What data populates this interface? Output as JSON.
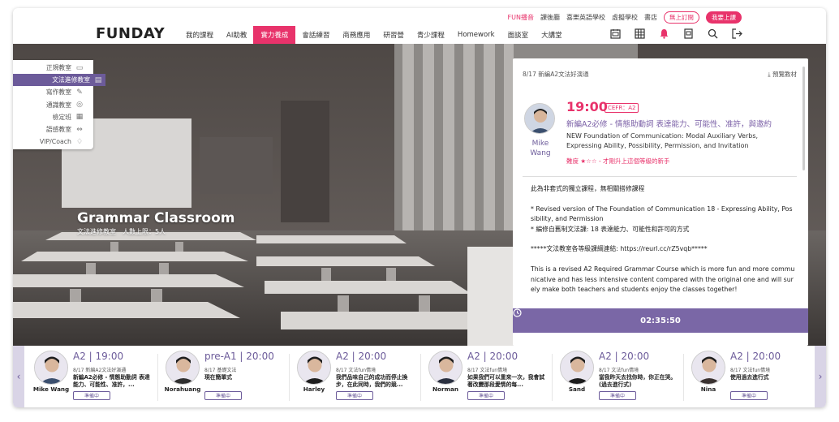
{
  "topbar": {
    "links": [
      "FUN播音",
      "課後廳",
      "喜樂英語學校",
      "虛擬學校",
      "書店"
    ],
    "pill_outline": "無上訂閱",
    "pill_fill": "我要上課"
  },
  "nav": {
    "logo": "FUNDAY",
    "items": [
      "我的課程",
      "AI助教",
      "實力養成",
      "會話練習",
      "商務應用",
      "研習營",
      "青少課程",
      "Homework",
      "面談室",
      "大講堂"
    ],
    "active_index": 2,
    "icons": [
      "calendar-icon",
      "grid-icon",
      "bell-icon",
      "book-icon",
      "search-icon",
      "logout-icon"
    ]
  },
  "left_menu": {
    "items": [
      {
        "label": "正規教室",
        "icon": "▭"
      },
      {
        "label": "文法進修教室",
        "icon": "▤"
      },
      {
        "label": "寫作教室",
        "icon": "✎"
      },
      {
        "label": "通識教室",
        "icon": "◎"
      },
      {
        "label": "檢定班",
        "icon": "▦"
      },
      {
        "label": "語感教室",
        "icon": "⇔"
      },
      {
        "label": "VIP/Coach",
        "icon": "♢"
      }
    ],
    "selected_index": 1
  },
  "hero": {
    "title": "Grammar Classroom",
    "subtitle": "文法進修教室　人數上限：5人"
  },
  "detail": {
    "date_label": "8/17 新編A2文法好演通",
    "download_label": "預覽教材",
    "time": "19:00",
    "cefr": "CEFR：A2",
    "teacher_name": "Mike Wang",
    "course_title": "新編A2必修 - 情態助動詞 表達能力、可能性、准許，與邀約",
    "course_en": "NEW Foundation of Communication: Modal Auxiliary Verbs, Expressing Ability, Possibility, Permission, and Invitation",
    "difficulty": "難度 ★☆☆ - 才剛升上這個等級的新手",
    "description": [
      "此為非套式的獨立課程，無相關搭修課程",
      "* Revised version of The Foundation of Communication 18 - Expressing Ability, Possibility, and Permission\n* 編修自舊制文法課: 18 表達能力、可能性和許可的方式",
      "*****文法教室各等級課綱連結: https://reurl.cc/rZ5vqb*****",
      "This is a revised A2 Required Grammar Course which is more fun and more communicative and has less intensive content compared with the original one and will surely make both teachers and students enjoy the classes together!"
    ],
    "countdown": "02:35:50",
    "colors": {
      "accent": "#e8336b",
      "purple": "#7a67a6"
    }
  },
  "carousel": [
    {
      "name": "Mike Wang",
      "level": "A2",
      "time": "19:00",
      "series": "8/17 新編A2文法好演通",
      "title": "新編A2必修 - 情態助動詞 表達能力、可能性、准許，...",
      "status": "準備中"
    },
    {
      "name": "Norahuang",
      "level": "pre-A1",
      "time": "20:00",
      "series": "8/17 基礎文法",
      "title": "現在簡單式",
      "status": "準備中"
    },
    {
      "name": "Harley",
      "level": "A2",
      "time": "20:00",
      "series": "8/17 文法fun情境",
      "title": "我們品味自己的成功而停止換步，在此同時，我們的競...",
      "status": "準備中"
    },
    {
      "name": "Norman",
      "level": "A2",
      "time": "20:00",
      "series": "8/17 文法fun情境",
      "title": "如果我們可以重來一次，我會試著改變那段愛情的每...",
      "status": "準備中"
    },
    {
      "name": "Sand",
      "level": "A2",
      "time": "20:00",
      "series": "8/17 文法fun情境",
      "title": "當我昨天去找你時，你正在哭。(過去進行式)",
      "status": "準備中"
    },
    {
      "name": "Nina",
      "level": "A2",
      "time": "20:00",
      "series": "8/17 文法fun情境",
      "title": "使用過去進行式",
      "status": "準備中"
    }
  ]
}
